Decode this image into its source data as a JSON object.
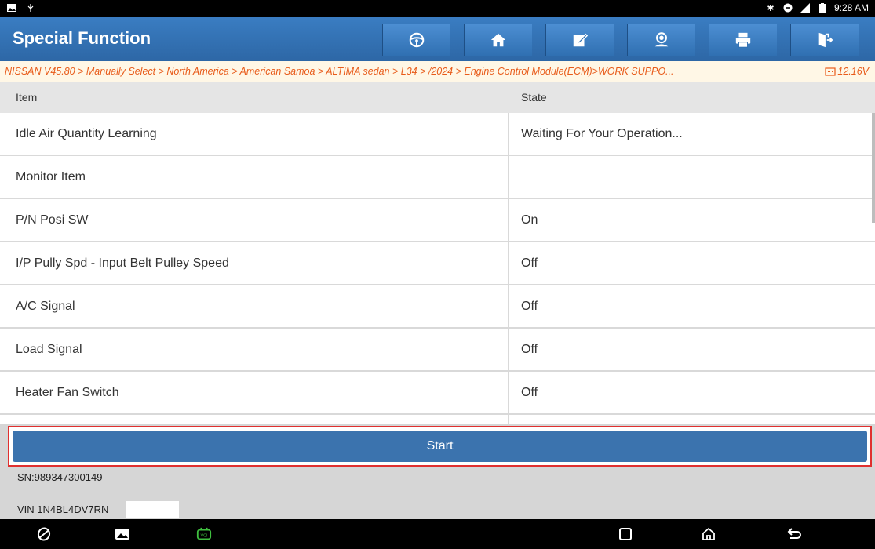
{
  "statusbar": {
    "time": "9:28 AM"
  },
  "header": {
    "title": "Special Function",
    "buttons": [
      "steering-wheel-icon",
      "home-icon",
      "edit-icon",
      "support-icon",
      "print-icon",
      "exit-icon"
    ]
  },
  "breadcrumb": {
    "path": "NISSAN V45.80 > Manually Select > North America > American Samoa > ALTIMA sedan > L34 > /2024 > Engine Control Module(ECM)>WORK SUPPO...",
    "voltage": "12.16V"
  },
  "table": {
    "col_item": "Item",
    "col_state": "State",
    "rows": [
      {
        "item": "Idle Air Quantity Learning",
        "state": "Waiting For Your Operation..."
      },
      {
        "item": "Monitor Item",
        "state": ""
      },
      {
        "item": "P/N Posi SW",
        "state": "On"
      },
      {
        "item": "I/P Pully Spd - Input Belt Pulley Speed",
        "state": "Off"
      },
      {
        "item": "A/C Signal",
        "state": "Off"
      },
      {
        "item": "Load Signal",
        "state": "Off"
      },
      {
        "item": "Heater Fan Switch",
        "state": "Off"
      }
    ]
  },
  "start_label": "Start",
  "info": {
    "sn": "SN:989347300149",
    "vin": "VIN 1N4BL4DV7RN"
  },
  "colors": {
    "header_blue": "#2d67a6",
    "breadcrumb_orange": "#e85b1a",
    "start_button": "#3b73ae",
    "highlight_red": "#e0302f"
  }
}
